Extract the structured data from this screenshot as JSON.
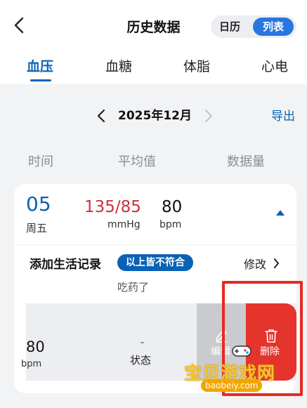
{
  "header": {
    "title": "历史数据",
    "view_toggle": {
      "calendar": "日历",
      "list": "列表",
      "selected": "列表"
    }
  },
  "tabs": [
    {
      "label": "血压",
      "active": true
    },
    {
      "label": "血糖",
      "active": false
    },
    {
      "label": "体脂",
      "active": false
    },
    {
      "label": "心电",
      "active": false
    }
  ],
  "month_nav": {
    "label": "2025年12月",
    "export_label": "导出"
  },
  "columns": [
    "时间",
    "平均值",
    "数据量"
  ],
  "record": {
    "day": "05",
    "weekday": "周五",
    "blood_pressure": "135/85",
    "bp_unit": "mmHg",
    "heart_rate": "80",
    "hr_unit": "bpm",
    "lifestyle_label": "添加生活记录",
    "badge": "以上皆不符合",
    "edit_label": "修改",
    "note": "吃药了"
  },
  "swipe_row": {
    "heart_rate": "80",
    "hr_unit": "bpm",
    "status_value": "-",
    "status_label": "状态",
    "edit_action": "编辑",
    "delete_action": "删除"
  },
  "watermark": {
    "text": "宝贝游戏网",
    "url": "baobeiy.com"
  },
  "colors": {
    "accent": "#0a62b6",
    "bp_value": "#c8323a",
    "delete": "#e5342b",
    "highlight": "#e8291e"
  }
}
